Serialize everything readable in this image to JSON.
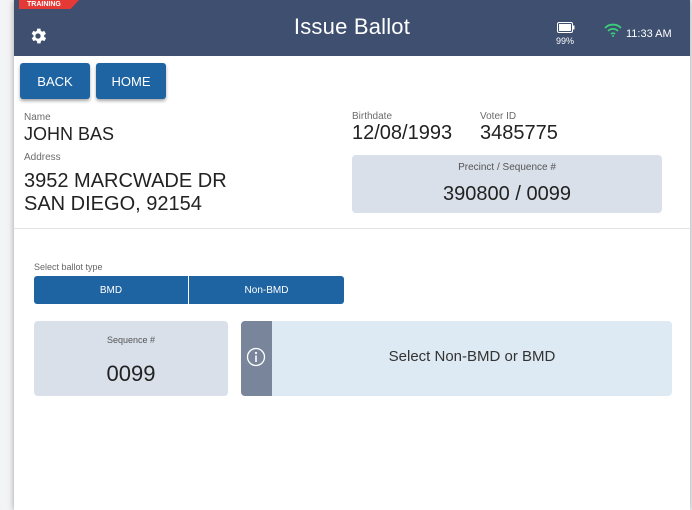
{
  "header": {
    "training_badge": "TRAINING",
    "title": "Issue Ballot",
    "battery_percent": "99%",
    "time": "11:33 AM",
    "icons": {
      "settings": "gear-icon",
      "battery": "battery-icon",
      "wifi": "wifi-icon"
    }
  },
  "nav": {
    "back_label": "BACK",
    "home_label": "HOME"
  },
  "voter": {
    "name_label": "Name",
    "name": "JOHN BAS",
    "address_label": "Address",
    "address_line1": "3952 MARCWADE DR",
    "address_line2": "SAN DIEGO, 92154",
    "birthdate_label": "Birthdate",
    "birthdate": "12/08/1993",
    "voter_id_label": "Voter ID",
    "voter_id": "3485775",
    "precinct_label": "Precinct / Sequence #",
    "precinct_value": "390800 / 0099"
  },
  "ballot": {
    "select_label": "Select ballot type",
    "options": [
      "BMD",
      "Non-BMD"
    ],
    "sequence_label": "Sequence #",
    "sequence_value": "0099",
    "info_message": "Select Non-BMD or BMD"
  },
  "colors": {
    "topbar": "#3e4f6f",
    "primary_button": "#1f64a2",
    "card": "#d9e0ea",
    "info_card": "#deeaf3",
    "info_strip": "#78859b",
    "training": "#e53935",
    "wifi": "#3ad07a"
  }
}
